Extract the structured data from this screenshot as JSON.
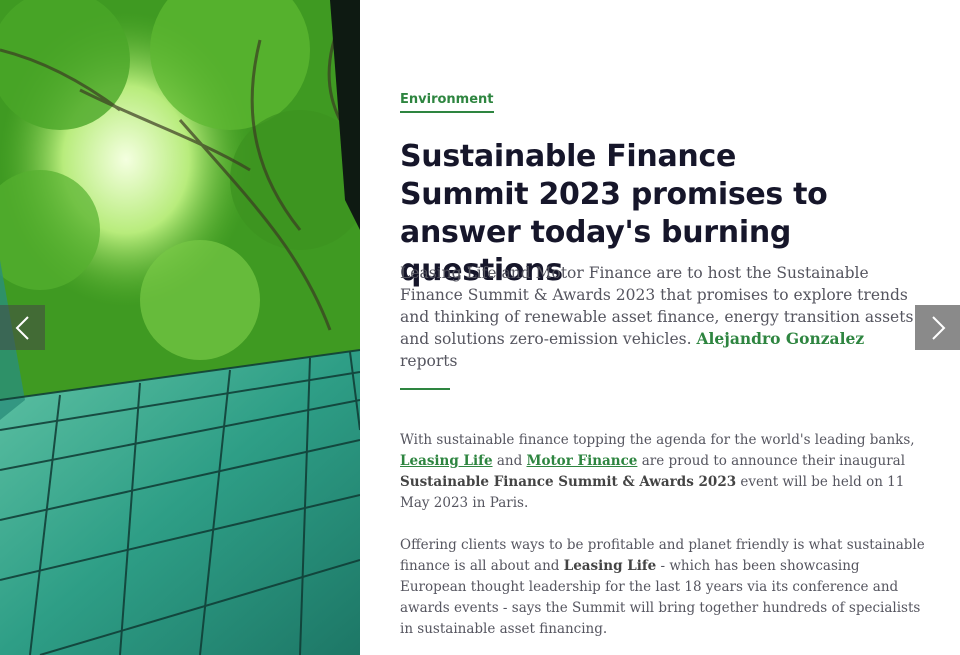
{
  "article": {
    "category": "Environment",
    "title": "Sustainable Finance Summit 2023 promises to answer today's burning questions",
    "standfirst_text": "Leasing Life and Motor Finance are to host the Sustainable Finance Summit & Awards 2023 that promises to explore trends and thinking of renewable asset finance, energy transition assets and solutions zero-emission vehicles. ",
    "author": "Alejandro Gonzalez",
    "standfirst_suffix": " reports",
    "p1": {
      "intro": "With sustainable finance topping the agenda for the world's leading banks, ",
      "link1": "Leasing Life",
      "and": " and ",
      "link2": "Motor Finance",
      "mid": " are proud to announce their inaugural ",
      "event": "Sustainable Finance Summit & Awards 2023",
      "end": " event will be held on 11 May 2023 in Paris."
    },
    "p2": {
      "intro": "Offering clients ways to be profitable and planet friendly is what sustainable finance is all about and ",
      "brand": "Leasing Life",
      "end": " - which has been showcasing European thought leadership for the last 18 years via its conference and awards events - says the Summit will bring together hundreds of specialists in sustainable asset financing."
    }
  },
  "carousel": {
    "prev_icon": "chevron-left-icon",
    "next_icon": "chevron-right-icon"
  },
  "colors": {
    "accent": "#2e8540",
    "title": "#16162a",
    "text": "#55555f"
  }
}
